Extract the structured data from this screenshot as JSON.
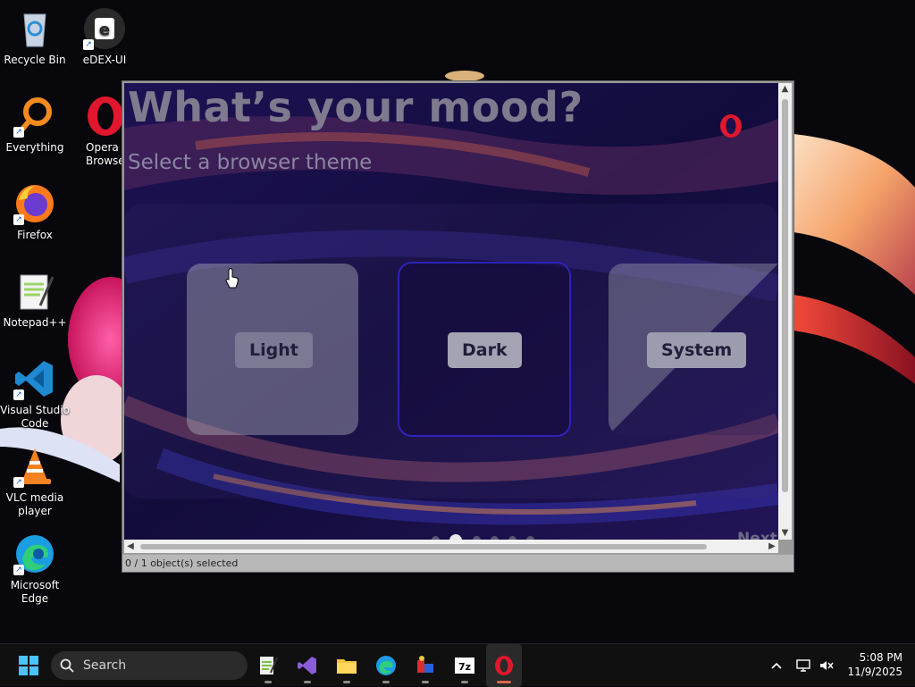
{
  "desktop": {
    "icons": [
      {
        "label": "Recycle Bin",
        "icon": "recycle-bin-icon"
      },
      {
        "label": "eDEX-UI",
        "icon": "edex-ui-icon"
      },
      {
        "label": "Everything",
        "icon": "everything-search-icon"
      },
      {
        "label": "Opera Browser",
        "icon": "opera-browser-icon"
      },
      {
        "label": "Firefox",
        "icon": "firefox-icon"
      },
      {
        "label": "Notepad++",
        "icon": "notepad-plus-plus-icon"
      },
      {
        "label": "Visual Studio Code",
        "icon": "vscode-icon"
      },
      {
        "label": "VLC media player",
        "icon": "vlc-icon"
      },
      {
        "label": "Microsoft Edge",
        "icon": "edge-icon"
      }
    ]
  },
  "window": {
    "onboarding": {
      "title": "What’s your mood?",
      "subtitle": "Select a browser theme",
      "themes": [
        "Light",
        "Dark",
        "System"
      ],
      "selected_theme": "Dark",
      "pager_total": 6,
      "pager_active": 2,
      "next_label": "Next"
    },
    "status_text": "0 / 1 object(s) selected"
  },
  "taskbar": {
    "search_placeholder": "Search",
    "apps": [
      "notepad-plus-plus-icon",
      "visual-studio-icon",
      "file-explorer-icon",
      "edge-icon",
      "app-icon",
      "7zip-icon",
      "opera-icon"
    ],
    "active_app": "opera-icon",
    "time": "5:08 PM",
    "date": "11/9/2025"
  },
  "colors": {
    "opera_red": "#e0172d",
    "dark_card_border": "#2d23b8",
    "taskbar_bg": "#101010"
  }
}
